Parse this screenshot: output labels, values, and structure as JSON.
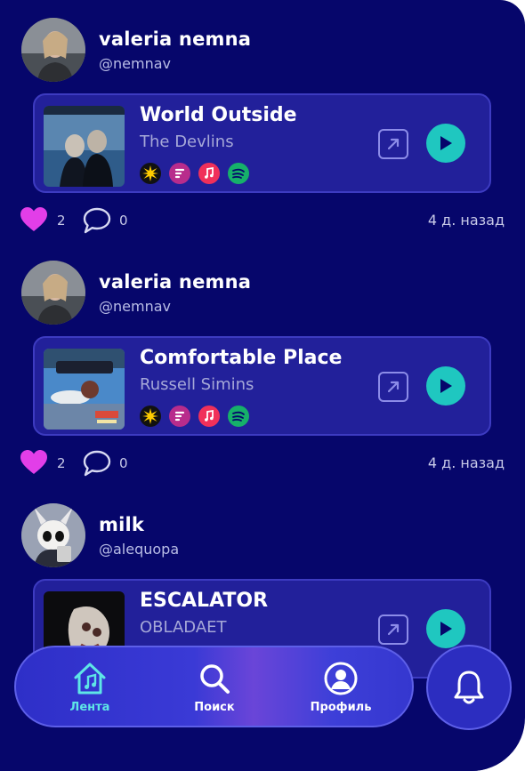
{
  "posts": [
    {
      "user": {
        "name": "valeria nemna",
        "handle": "@nemnav"
      },
      "track": {
        "title": "World Outside",
        "artist": "The Devlins"
      },
      "likes": "2",
      "comments": "0",
      "time": "4 д. назад"
    },
    {
      "user": {
        "name": "valeria nemna",
        "handle": "@nemnav"
      },
      "track": {
        "title": "Comfortable Place",
        "artist": "Russell Simins"
      },
      "likes": "2",
      "comments": "0",
      "time": "4 д. назад"
    },
    {
      "user": {
        "name": "milk",
        "handle": "@alequopa"
      },
      "track": {
        "title": "ESCALATOR",
        "artist": "OBLADAET"
      }
    }
  ],
  "services": [
    "yandex-music-icon",
    "vk-music-icon",
    "apple-music-icon",
    "spotify-icon"
  ],
  "nav": {
    "items": [
      {
        "label": "Лента",
        "icon": "home-music-icon",
        "active": true
      },
      {
        "label": "Поиск",
        "icon": "search-icon",
        "active": false
      },
      {
        "label": "Профиль",
        "icon": "profile-icon",
        "active": false
      }
    ],
    "notifications_icon": "bell-icon"
  },
  "colors": {
    "background": "#06066b",
    "card": "#22209a",
    "accent": "#1fc7c0",
    "like": "#e23ee8",
    "active_nav": "#5ee6e6"
  }
}
